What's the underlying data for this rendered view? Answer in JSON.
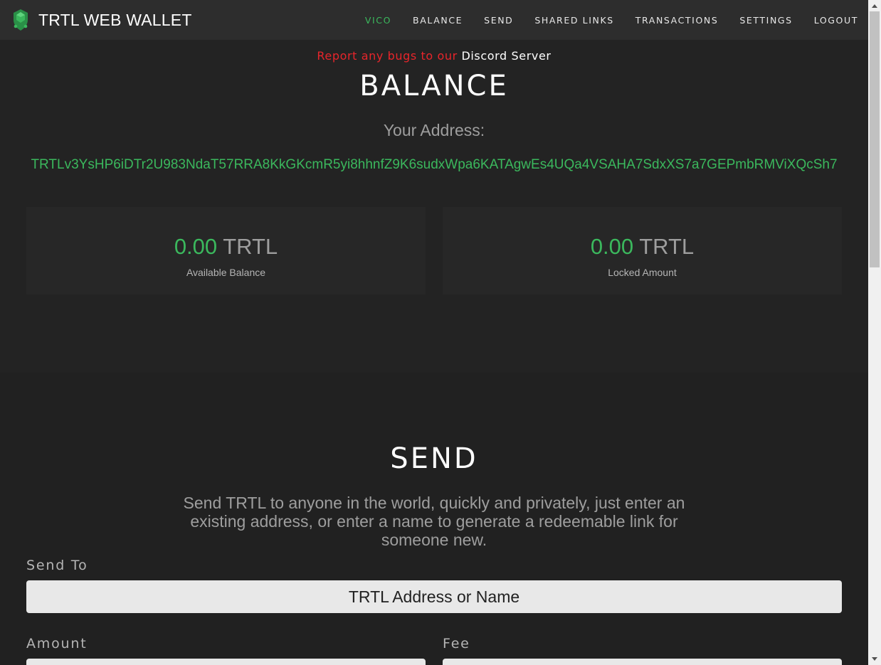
{
  "navbar": {
    "brand": "TRTL WEB WALLET",
    "links": [
      "VICO",
      "BALANCE",
      "SEND",
      "SHARED LINKS",
      "TRANSACTIONS",
      "SETTINGS",
      "LOGOUT"
    ],
    "active_index": 0,
    "brand_color": "#3bb85d"
  },
  "banner": {
    "text": "Report any bugs to our ",
    "link": "Discord Server",
    "text_color": "#e8252b"
  },
  "balance": {
    "title": "BALANCE",
    "address_label": "Your Address:",
    "address": "TRTLv3YsHP6iDTr2U983NdaT57RRA8KkGKcmR5yi8hhnfZ9K6sudxWpa6KATAgwEs4UQa4VSAHA7SdxXS7a7GEPmbRMViXQcSh7",
    "cards": [
      {
        "amount": "0.00",
        "unit": "TRTL",
        "label": "Available Balance"
      },
      {
        "amount": "0.00",
        "unit": "TRTL",
        "label": "Locked Amount"
      }
    ]
  },
  "send": {
    "title": "SEND",
    "description": "Send TRTL to anyone in the world, quickly and privately, just enter an existing address, or enter a name to generate a redeemable link for someone new.",
    "send_to_label": "Send To",
    "send_to_placeholder": "TRTL Address or Name",
    "amount_label": "Amount",
    "fee_label": "Fee"
  }
}
